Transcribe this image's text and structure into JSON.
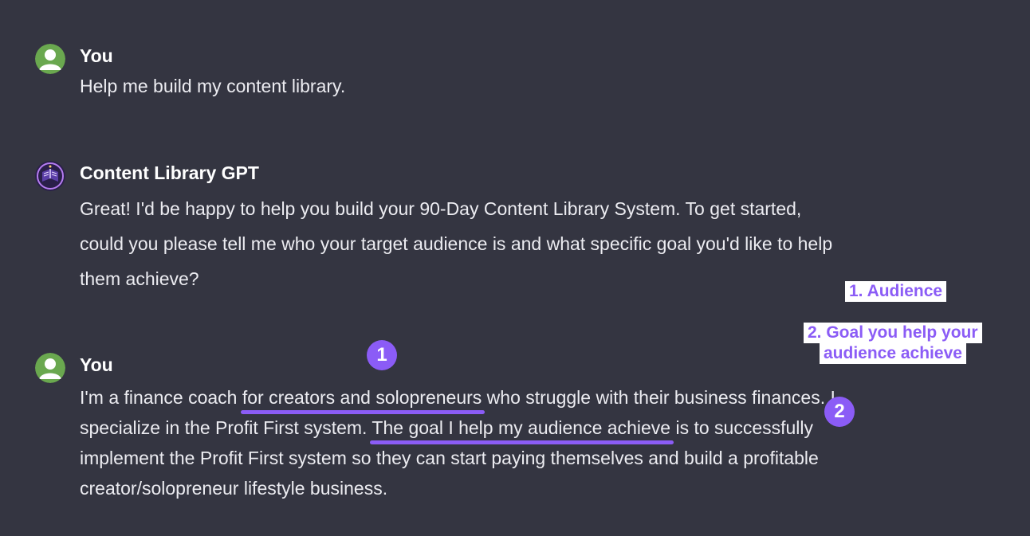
{
  "colors": {
    "background": "#343541",
    "user_avatar": "#6aa84f",
    "accent": "#8b5cf6"
  },
  "messages": [
    {
      "author": "You",
      "avatar_icon": "user-avatar-icon",
      "text": "Help me build my content library."
    },
    {
      "author": "Content Library GPT",
      "avatar_icon": "gpt-logo-icon",
      "text": "Great! I'd be happy to help you build your 90-Day Content Library System. To get started, could you please tell me who your target audience is and what specific goal you'd like to help them achieve?"
    },
    {
      "author": "You",
      "avatar_icon": "user-avatar-icon",
      "text_parts": {
        "p1": "I'm a finance coach ",
        "highlight1": "for creators and solopreneurs",
        "p2": " who struggle with their business finances. I specialize in the Profit First system. ",
        "highlight2": "The goal I help my audience achieve",
        "p3": " is to successfully implement the Profit First system so they can start paying themselves and build a profitable creator/solopreneur lifestyle business."
      }
    }
  ],
  "annotations": {
    "marker1": "1",
    "marker2": "2",
    "note1": "1. Audience",
    "note2_line1": "2. Goal you help your",
    "note2_line2": "audience achieve"
  }
}
